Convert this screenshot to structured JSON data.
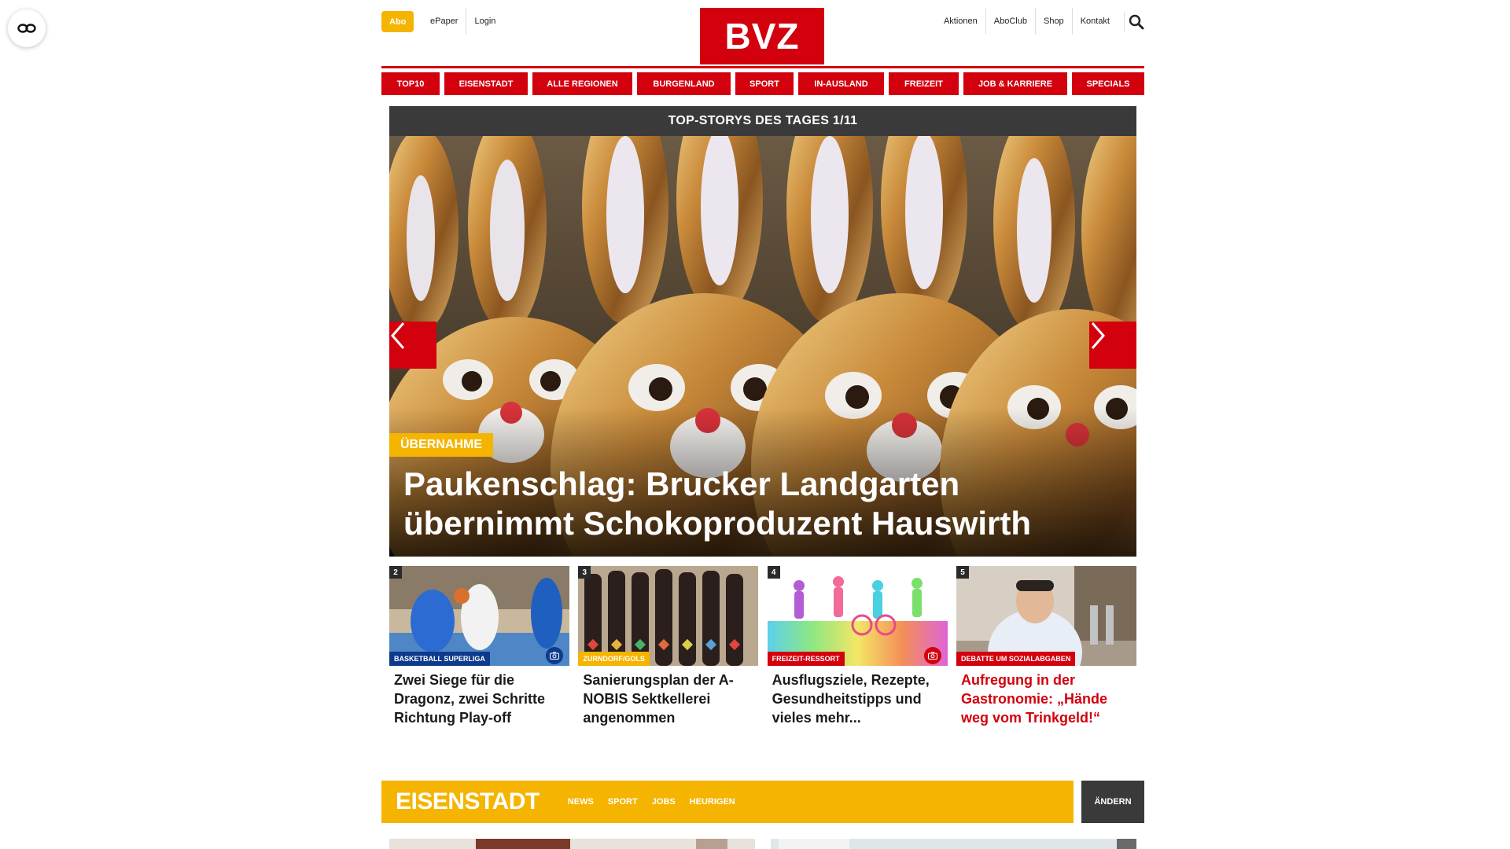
{
  "header": {
    "abo_label": "Abo",
    "left_links": [
      "ePaper",
      "Login"
    ],
    "logo_text": "BVZ",
    "right_links": [
      "Aktionen",
      "AboClub",
      "Shop",
      "Kontakt"
    ]
  },
  "nav": {
    "items": [
      "TOP10",
      "EISENSTADT",
      "ALLE REGIONEN",
      "BURGENLAND",
      "SPORT",
      "IN-AUSLAND",
      "FREIZEIT",
      "JOB & KARRIERE",
      "SPECIALS"
    ]
  },
  "hero": {
    "heading": "TOP-STORYS DES TAGES 1/11",
    "tag": "ÜBERNAHME",
    "title": "Paukenschlag: Brucker Landgarten übernimmt Schokoproduzent Hauswirth"
  },
  "cards": [
    {
      "num": "2",
      "tag": "BASKETBALL SUPERLIGA",
      "tag_color": "#0d3a8c",
      "title": "Zwei Siege für die Dragonz, zwei Schritte Richtung Play-off",
      "camera": true,
      "cam_color": "#0d3a8c"
    },
    {
      "num": "3",
      "tag": "ZURNDORF/GOLS",
      "tag_color": "#f5b400",
      "title": "Sanierungsplan der A-NOBIS Sektkellerei angenommen",
      "camera": false
    },
    {
      "num": "4",
      "tag": "FREIZEIT-RESSORT",
      "tag_color": "#d3000d",
      "title": "Ausflugsziele, Rezepte, Gesundheitstipps und vieles mehr...",
      "camera": true,
      "cam_color": "#d3000d"
    },
    {
      "num": "5",
      "tag": "DEBATTE UM SOZIALABGABEN",
      "tag_color": "#d3000d",
      "title": "Aufregung in der Gastronomie: „Hände weg vom Trinkgeld!“",
      "camera": false,
      "title_red": true
    }
  ],
  "region": {
    "name": "EISENSTADT",
    "links": [
      "NEWS",
      "SPORT",
      "JOBS",
      "HEURIGEN"
    ],
    "change_label": "ÄNDERN"
  },
  "colors": {
    "brand_red": "#d3000d",
    "accent_yellow": "#f5b400",
    "dark_gray": "#3a3a3a"
  },
  "icons": {
    "reader": "glasses-icon",
    "search": "search-icon",
    "prev": "chevron-left-icon",
    "next": "chevron-right-icon",
    "camera": "camera-icon"
  }
}
